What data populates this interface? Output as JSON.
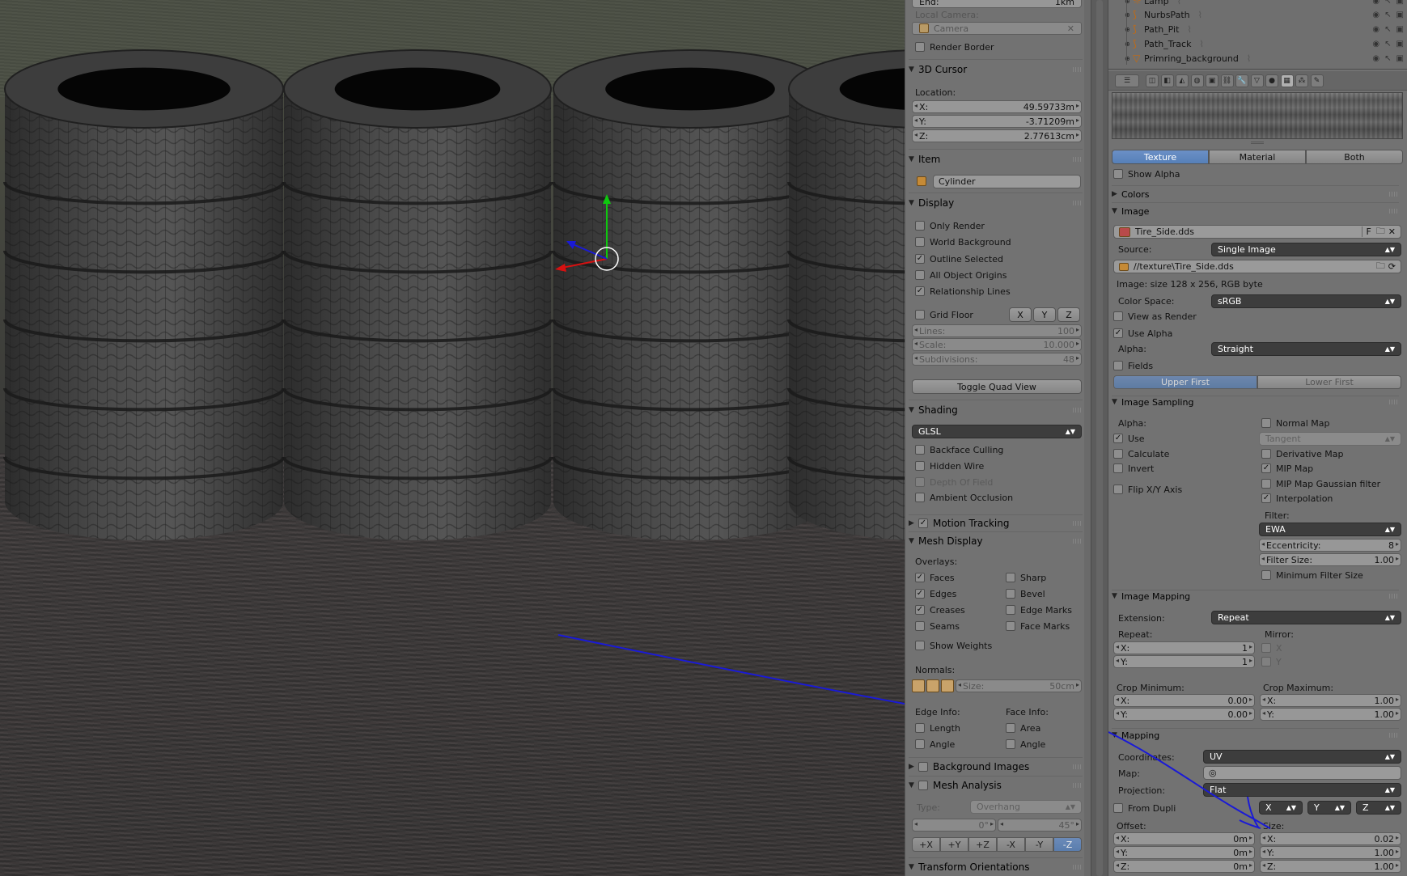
{
  "view_props": {
    "top_field": {
      "key": "End:",
      "value": "1km"
    },
    "local_camera_label": "Local Camera:",
    "camera_value": "Camera",
    "render_border": "Render Border",
    "cursor": {
      "title": "3D Cursor",
      "location_label": "Location:",
      "x": {
        "key": "X:",
        "value": "49.59733m"
      },
      "y": {
        "key": "Y:",
        "value": "-3.71209m"
      },
      "z": {
        "key": "Z:",
        "value": "2.77613cm"
      }
    },
    "item": {
      "title": "Item",
      "name": "Cylinder"
    },
    "display": {
      "title": "Display",
      "checks": [
        {
          "label": "Only Render",
          "checked": false
        },
        {
          "label": "World Background",
          "checked": false
        },
        {
          "label": "Outline Selected",
          "checked": true
        },
        {
          "label": "All Object Origins",
          "checked": false
        },
        {
          "label": "Relationship Lines",
          "checked": true
        }
      ],
      "grid_floor": "Grid Floor",
      "axes": [
        "X",
        "Y",
        "Z"
      ],
      "lines": {
        "key": "Lines:",
        "value": "100"
      },
      "scale": {
        "key": "Scale:",
        "value": "10.000"
      },
      "subdivisions": {
        "key": "Subdivisions:",
        "value": "48"
      },
      "toggle_quad": "Toggle Quad View"
    },
    "shading": {
      "title": "Shading",
      "mode": "GLSL",
      "checks": [
        {
          "label": "Backface Culling",
          "checked": false,
          "dim": false
        },
        {
          "label": "Hidden Wire",
          "checked": false,
          "dim": false
        },
        {
          "label": "Depth Of Field",
          "checked": false,
          "dim": true
        },
        {
          "label": "Ambient Occlusion",
          "checked": false,
          "dim": false
        }
      ]
    },
    "motion_tracking": "Motion Tracking",
    "mesh_display": {
      "title": "Mesh Display",
      "overlays_label": "Overlays:",
      "left": [
        {
          "label": "Faces",
          "checked": true
        },
        {
          "label": "Edges",
          "checked": true
        },
        {
          "label": "Creases",
          "checked": true
        },
        {
          "label": "Seams",
          "checked": false
        }
      ],
      "right": [
        {
          "label": "Sharp",
          "checked": false
        },
        {
          "label": "Bevel",
          "checked": false
        },
        {
          "label": "Edge Marks",
          "checked": false
        },
        {
          "label": "Face Marks",
          "checked": false
        }
      ],
      "show_weights": "Show Weights",
      "normals_label": "Normals:",
      "normal_size": {
        "key": "Size:",
        "value": "50cm"
      },
      "edge_info": "Edge Info:",
      "face_info": "Face Info:",
      "edge_checks": [
        "Length",
        "Angle"
      ],
      "face_checks": [
        "Area",
        "Angle"
      ]
    },
    "background_images": "Background Images",
    "mesh_analysis": {
      "title": "Mesh Analysis",
      "type_label": "Type:",
      "type_value": "Overhang",
      "min": "0°",
      "max": "45°",
      "axes": [
        "+X",
        "+Y",
        "+Z",
        "-X",
        "-Y",
        "-Z"
      ],
      "active_axis": "-Z"
    },
    "transform_orientations": "Transform Orientations"
  },
  "outliner": {
    "rows": [
      {
        "name": "Lamp"
      },
      {
        "name": "NurbsPath"
      },
      {
        "name": "Path_Pit"
      },
      {
        "name": "Path_Track"
      },
      {
        "name": "Primring_background"
      }
    ]
  },
  "texture": {
    "preview_tabs": [
      "Texture",
      "Material",
      "Both"
    ],
    "active_preview_tab": "Texture",
    "show_alpha": "Show Alpha",
    "colors": "Colors",
    "image_section": "Image",
    "image_name": "Tire_Side.dds",
    "image_f": "F",
    "source_label": "Source:",
    "source_value": "Single Image",
    "path": "//texture\\Tire_Side.dds",
    "image_info": "Image: size 128 x 256, RGB byte",
    "color_space_label": "Color Space:",
    "color_space_value": "sRGB",
    "view_as_render": "View as Render",
    "use_alpha": "Use Alpha",
    "alpha_label": "Alpha:",
    "alpha_value": "Straight",
    "fields": "Fields",
    "field_order": [
      "Upper First",
      "Lower First"
    ],
    "image_sampling": {
      "title": "Image Sampling",
      "alpha_label": "Alpha:",
      "use": "Use",
      "calculate": "Calculate",
      "invert": "Invert",
      "flip": "Flip X/Y Axis",
      "normal_map": "Normal Map",
      "tangent": "Tangent",
      "derivative_map": "Derivative Map",
      "mip_map": "MIP Map",
      "mip_gauss": "MIP Map Gaussian filter",
      "interpolation": "Interpolation",
      "filter_label": "Filter:",
      "filter_value": "EWA",
      "eccentricity": {
        "key": "Eccentricity:",
        "value": "8"
      },
      "filter_size": {
        "key": "Filter Size:",
        "value": "1.00"
      },
      "min_filter": "Minimum Filter Size"
    },
    "image_mapping": {
      "title": "Image Mapping",
      "extension_label": "Extension:",
      "extension_value": "Repeat",
      "repeat_label": "Repeat:",
      "mirror_label": "Mirror:",
      "repeat_x": {
        "key": "X:",
        "value": "1"
      },
      "repeat_y": {
        "key": "Y:",
        "value": "1"
      },
      "mirror_x": "X",
      "mirror_y": "Y",
      "crop_min_label": "Crop Minimum:",
      "crop_max_label": "Crop Maximum:",
      "crop_min_x": {
        "key": "X:",
        "value": "0.00"
      },
      "crop_min_y": {
        "key": "Y:",
        "value": "0.00"
      },
      "crop_max_x": {
        "key": "X:",
        "value": "1.00"
      },
      "crop_max_y": {
        "key": "Y:",
        "value": "1.00"
      }
    },
    "mapping": {
      "title": "Mapping",
      "coordinates_label": "Coordinates:",
      "coordinates_value": "UV",
      "map_label": "Map:",
      "projection_label": "Projection:",
      "projection_value": "Flat",
      "from_dupli": "From Dupli",
      "axis_x": "X",
      "axis_y": "Y",
      "axis_z": "Z",
      "offset_label": "Offset:",
      "size_label": "Size:",
      "offset": [
        {
          "key": "X:",
          "value": "0m"
        },
        {
          "key": "Y:",
          "value": "0m"
        },
        {
          "key": "Z:",
          "value": "0m"
        }
      ],
      "size": [
        {
          "key": "X:",
          "value": "0.02"
        },
        {
          "key": "Y:",
          "value": "1.00"
        },
        {
          "key": "Z:",
          "value": "1.00"
        }
      ]
    }
  },
  "colors": {
    "annotation_stroke": "#1a1ad6",
    "accent": "#5680b8",
    "widget": "#979797",
    "panel": "#727272"
  }
}
